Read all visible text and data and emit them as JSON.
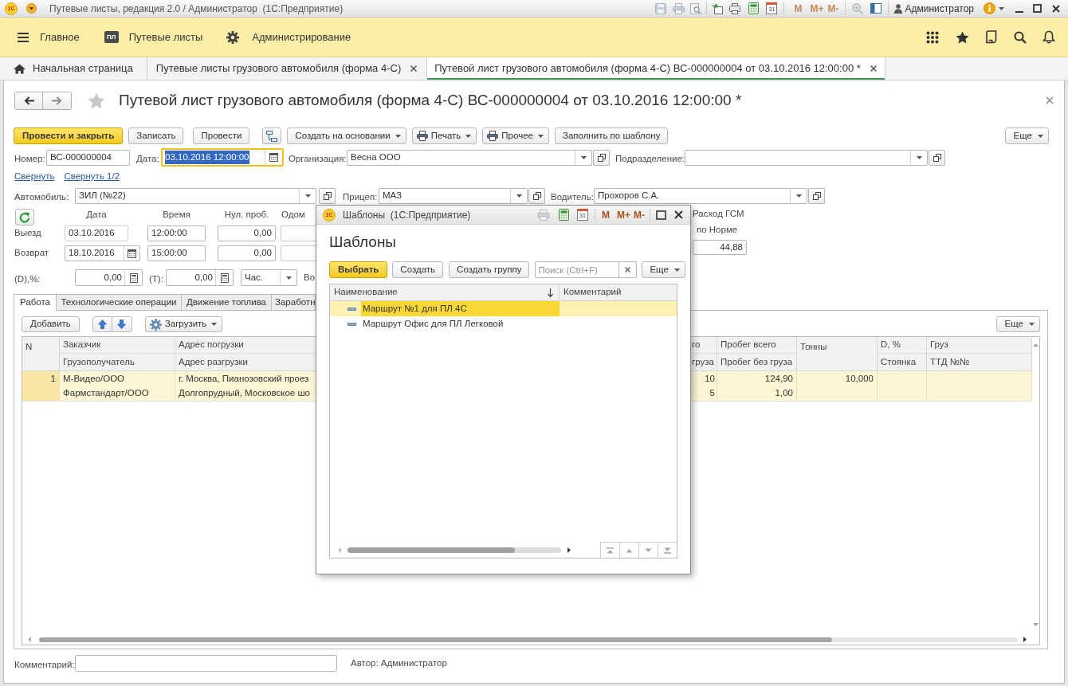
{
  "window": {
    "logo": "1С",
    "title": "Путевые листы, редакция 2.0 / Администратор  (1С:Предприятие)",
    "calendar_day": "31",
    "memory_buttons": [
      {
        "label": "M",
        "disabled": true
      },
      {
        "label": "M+",
        "disabled": true
      },
      {
        "label": "M-",
        "disabled": true
      }
    ],
    "user": "Администратор"
  },
  "sections": [
    {
      "kind": "menu",
      "label": "Главное"
    },
    {
      "kind": "badge",
      "badge": "ПЛ",
      "label": "Путевые листы"
    },
    {
      "kind": "gear",
      "label": "Администрирование"
    }
  ],
  "open_tabs": [
    {
      "kind": "home",
      "label": "Начальная страница",
      "closable": false,
      "selected": false
    },
    {
      "kind": "page",
      "label": "Путевые листы грузового автомобиля (форма 4-С)",
      "closable": true,
      "selected": false
    },
    {
      "kind": "page",
      "label": "Путевой лист грузового автомобиля (форма 4-С) ВС-000000004 от 03.10.2016 12:00:00 *",
      "closable": true,
      "selected": true
    }
  ],
  "document": {
    "title": "Путевой лист грузового автомобиля (форма 4-С) ВС-000000004 от 03.10.2016 12:00:00 *",
    "favorite": false,
    "toolbar": [
      {
        "kind": "primary",
        "label": "Провести и закрыть"
      },
      {
        "kind": "plain",
        "label": "Записать"
      },
      {
        "kind": "plain",
        "label": "Провести"
      },
      {
        "kind": "structure_icon"
      },
      {
        "kind": "dropdown",
        "label": "Создать на основании"
      },
      {
        "kind": "print_dropdown",
        "label": "Печать"
      },
      {
        "kind": "print_dropdown",
        "label": "Прочее"
      },
      {
        "kind": "plain",
        "label": "Заполнить по шаблону"
      }
    ],
    "more_button": "Еще",
    "header_fields": [
      {
        "kind": "text",
        "label": "Номер:",
        "value": "ВС-000000004"
      },
      {
        "kind": "date",
        "label": "Дата:",
        "value": "03.10.2016 12:00:00",
        "focused": true
      },
      {
        "kind": "choice",
        "label": "Организация:",
        "value": "Весна ООО"
      },
      {
        "kind": "choice",
        "label": "Подразделение:"
      }
    ],
    "collapse_links": [
      "Свернуть",
      "Свернуть 1/2"
    ],
    "vehicle_fields": [
      {
        "kind": "choice",
        "label": "Автомобиль:",
        "value": "ЗИЛ (№22)"
      },
      {
        "kind": "choice",
        "label": "Прицеп:",
        "value": "МАЗ"
      },
      {
        "kind": "choice",
        "label": "Водитель:",
        "value": "Прохоров С.А."
      }
    ],
    "trip": {
      "columns": [
        "Дата",
        "Время",
        "Нул. проб.",
        "Одом"
      ],
      "rows": [
        {
          "label": "Выезд",
          "date": "03.10.2016",
          "read_only": true,
          "time": "12:00:00",
          "zero_run": "0,00"
        },
        {
          "label": "Возврат",
          "date": "18.10.2016",
          "read_only": false,
          "time": "15:00:00",
          "zero_run": "0,00"
        }
      ]
    },
    "fuel": {
      "title": "Расход ГСМ",
      "column": "по Норме",
      "value": "44,88"
    },
    "rates": [
      {
        "label": "(D),%:",
        "value": "0,00"
      },
      {
        "label": "(T):",
        "value": "0,00"
      }
    ],
    "unit": "Час.",
    "cut_label": "Во",
    "tabs": [
      {
        "label": "Работа",
        "selected": true
      },
      {
        "label": "Технологические операции",
        "selected": false
      },
      {
        "label": "Движение топлива",
        "selected": false
      },
      {
        "label": "Заработн",
        "selected": false
      }
    ],
    "work_toolbar": {
      "add": "Добавить",
      "load": "Загрузить",
      "more_button": "Еще"
    },
    "work_table": {
      "columns": [
        {
          "title": "N"
        },
        {
          "title": "Заказчик",
          "subtitle": "Грузополучатель"
        },
        {
          "title": "Адрес погрузки",
          "subtitle": "Адрес разгрузки"
        },
        {
          "title": "го",
          "subtitle": "груза"
        },
        {
          "title": "Пробег всего",
          "subtitle": "Пробег без груза"
        },
        {
          "title": "Тонны"
        },
        {
          "title": "D, %",
          "subtitle": "Стоянка"
        },
        {
          "title": "Груз",
          "subtitle": "ТТД №№"
        }
      ],
      "rows": [
        {
          "selected": true,
          "n": "1",
          "customer": "М-Видео/ООО",
          "consignee": "Фармстандарт/ООО",
          "loading_address": "г. Москва, Пианозовский проез",
          "unloading_address": "Долгопрудный, Московское шо",
          "column_4_line_1": "10",
          "column_4_line_2": "5",
          "mileage_total": "124,90",
          "mileage_empty": "1,00",
          "tons": "10,000"
        }
      ]
    },
    "comment": {
      "label": "Комментарий:"
    },
    "author": "Автор: Администратор"
  },
  "templates_dialog": {
    "logo": "1С",
    "title": "Шаблоны  (1С:Предприятие)",
    "calendar_day": "31",
    "memory_buttons": [
      {
        "label": "M",
        "disabled": false
      },
      {
        "label": "M+",
        "disabled": false
      },
      {
        "label": "M-",
        "disabled": false
      }
    ],
    "heading": "Шаблоны",
    "toolbar": [
      {
        "kind": "primary",
        "label": "Выбрать"
      },
      {
        "kind": "plain",
        "label": "Создать"
      },
      {
        "kind": "plain",
        "label": "Создать группу"
      }
    ],
    "search": {
      "placeholder": "Поиск (Ctrl+F)"
    },
    "more_button": "Еще",
    "columns": [
      {
        "title": "Наименование",
        "sorted": true
      },
      {
        "title": "Комментарий",
        "sorted": false
      }
    ],
    "rows": [
      {
        "name": "Маршрут №1 для ПЛ 4С",
        "selected": true
      },
      {
        "name": "Маршрут Офис для ПЛ Легковой",
        "selected": false
      }
    ]
  }
}
